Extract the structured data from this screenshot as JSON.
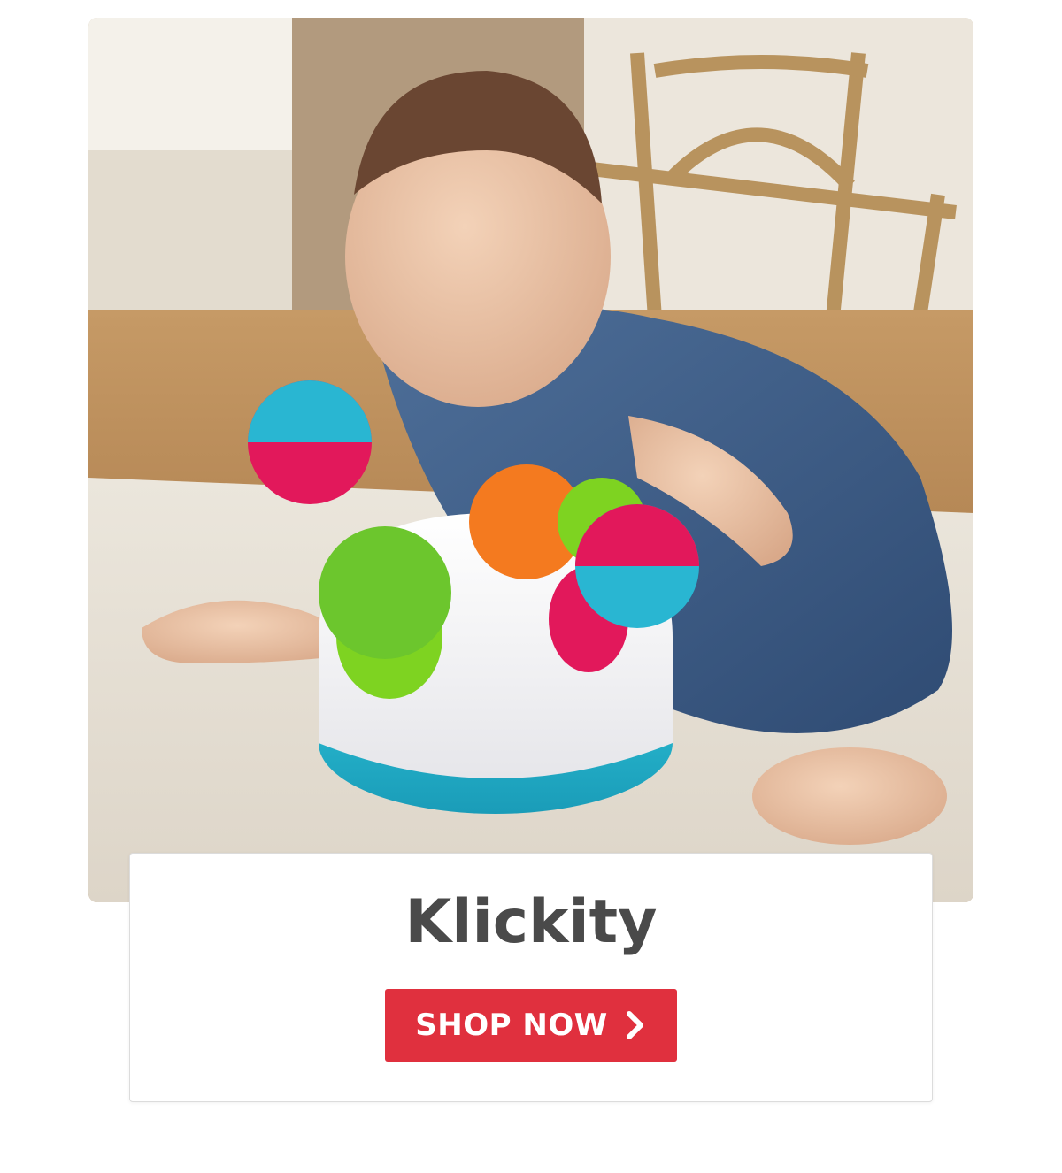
{
  "product": {
    "name": "Klickity"
  },
  "cta": {
    "label": "SHOP NOW",
    "icon": "chevron-right-icon"
  },
  "colors": {
    "button": "#e0303e",
    "title": "#4a4a4a"
  }
}
